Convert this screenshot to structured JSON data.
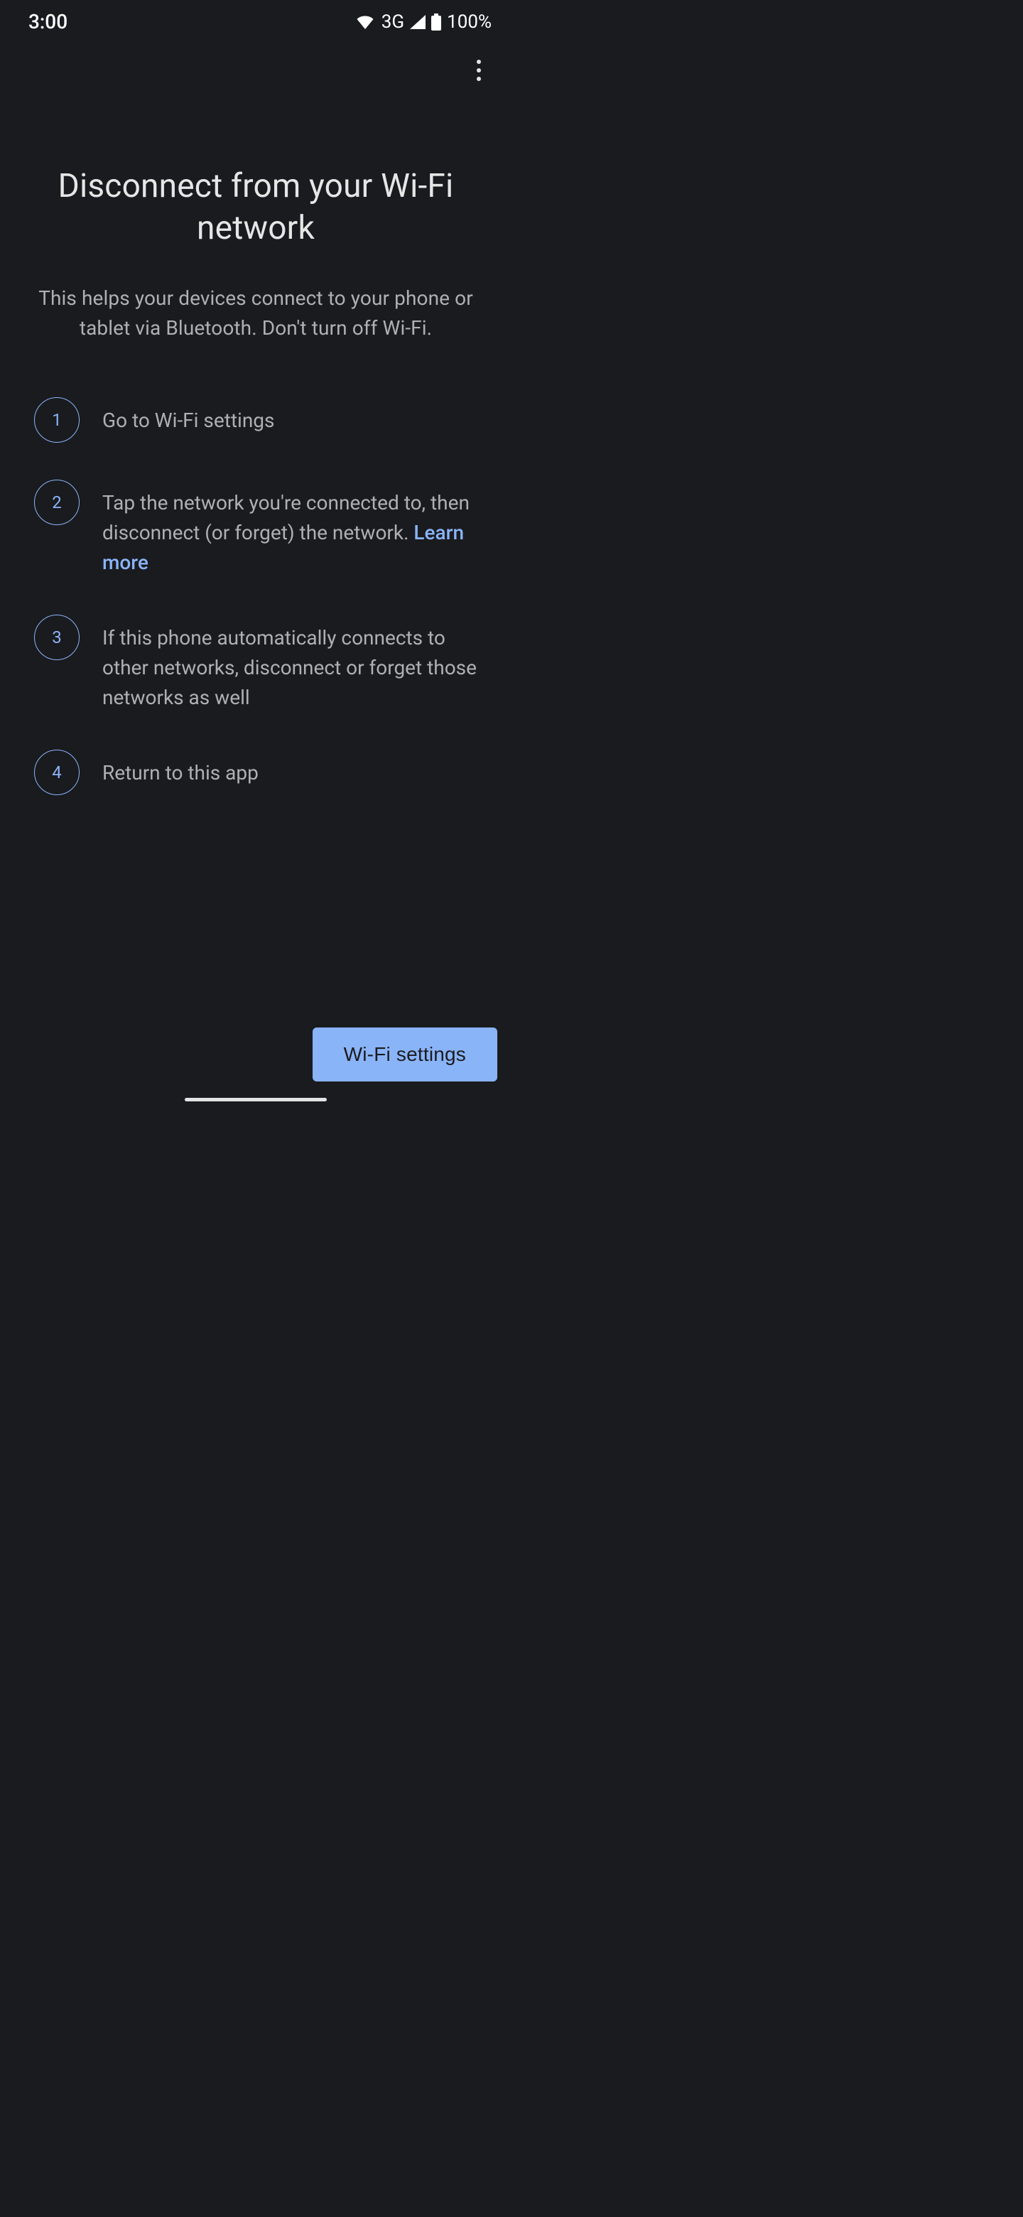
{
  "status_bar": {
    "time": "3:00",
    "network_label": "3G",
    "battery_text": "100%"
  },
  "page": {
    "title": "Disconnect from your Wi-Fi network",
    "subtitle": "This helps your devices connect to your phone or tablet via Bluetooth. Don't turn off Wi-Fi."
  },
  "steps": [
    {
      "num": "1",
      "text": "Go to Wi-Fi settings",
      "link": ""
    },
    {
      "num": "2",
      "text": "Tap the network you're connected to, then disconnect (or forget) the network. ",
      "link": "Learn more"
    },
    {
      "num": "3",
      "text": "If this phone automatically connects to other networks, disconnect or forget those networks as well",
      "link": ""
    },
    {
      "num": "4",
      "text": "Return to this app",
      "link": ""
    }
  ],
  "bottom_button": "Wi-Fi settings"
}
